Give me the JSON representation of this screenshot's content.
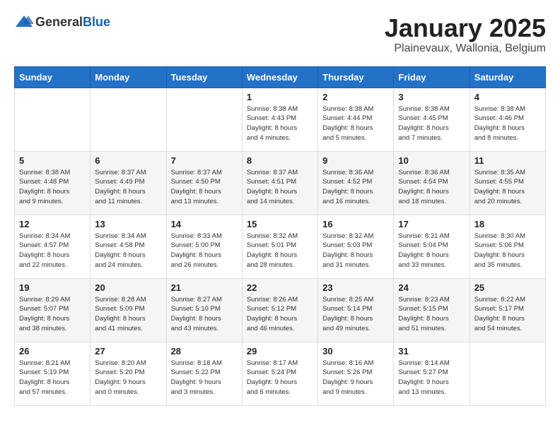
{
  "header": {
    "logo_general": "General",
    "logo_blue": "Blue",
    "month_title": "January 2025",
    "subtitle": "Plainevaux, Wallonia, Belgium"
  },
  "days_of_week": [
    "Sunday",
    "Monday",
    "Tuesday",
    "Wednesday",
    "Thursday",
    "Friday",
    "Saturday"
  ],
  "weeks": [
    [
      {
        "day": "",
        "info": ""
      },
      {
        "day": "",
        "info": ""
      },
      {
        "day": "",
        "info": ""
      },
      {
        "day": "1",
        "info": "Sunrise: 8:38 AM\nSunset: 4:43 PM\nDaylight: 8 hours\nand 4 minutes."
      },
      {
        "day": "2",
        "info": "Sunrise: 8:38 AM\nSunset: 4:44 PM\nDaylight: 8 hours\nand 5 minutes."
      },
      {
        "day": "3",
        "info": "Sunrise: 8:38 AM\nSunset: 4:45 PM\nDaylight: 8 hours\nand 7 minutes."
      },
      {
        "day": "4",
        "info": "Sunrise: 8:38 AM\nSunset: 4:46 PM\nDaylight: 8 hours\nand 8 minutes."
      }
    ],
    [
      {
        "day": "5",
        "info": "Sunrise: 8:38 AM\nSunset: 4:48 PM\nDaylight: 8 hours\nand 9 minutes."
      },
      {
        "day": "6",
        "info": "Sunrise: 8:37 AM\nSunset: 4:49 PM\nDaylight: 8 hours\nand 11 minutes."
      },
      {
        "day": "7",
        "info": "Sunrise: 8:37 AM\nSunset: 4:50 PM\nDaylight: 8 hours\nand 13 minutes."
      },
      {
        "day": "8",
        "info": "Sunrise: 8:37 AM\nSunset: 4:51 PM\nDaylight: 8 hours\nand 14 minutes."
      },
      {
        "day": "9",
        "info": "Sunrise: 8:36 AM\nSunset: 4:52 PM\nDaylight: 8 hours\nand 16 minutes."
      },
      {
        "day": "10",
        "info": "Sunrise: 8:36 AM\nSunset: 4:54 PM\nDaylight: 8 hours\nand 18 minutes."
      },
      {
        "day": "11",
        "info": "Sunrise: 8:35 AM\nSunset: 4:55 PM\nDaylight: 8 hours\nand 20 minutes."
      }
    ],
    [
      {
        "day": "12",
        "info": "Sunrise: 8:34 AM\nSunset: 4:57 PM\nDaylight: 8 hours\nand 22 minutes."
      },
      {
        "day": "13",
        "info": "Sunrise: 8:34 AM\nSunset: 4:58 PM\nDaylight: 8 hours\nand 24 minutes."
      },
      {
        "day": "14",
        "info": "Sunrise: 8:33 AM\nSunset: 5:00 PM\nDaylight: 8 hours\nand 26 minutes."
      },
      {
        "day": "15",
        "info": "Sunrise: 8:32 AM\nSunset: 5:01 PM\nDaylight: 8 hours\nand 28 minutes."
      },
      {
        "day": "16",
        "info": "Sunrise: 8:32 AM\nSunset: 5:03 PM\nDaylight: 8 hours\nand 31 minutes."
      },
      {
        "day": "17",
        "info": "Sunrise: 8:31 AM\nSunset: 5:04 PM\nDaylight: 8 hours\nand 33 minutes."
      },
      {
        "day": "18",
        "info": "Sunrise: 8:30 AM\nSunset: 5:06 PM\nDaylight: 8 hours\nand 35 minutes."
      }
    ],
    [
      {
        "day": "19",
        "info": "Sunrise: 8:29 AM\nSunset: 5:07 PM\nDaylight: 8 hours\nand 38 minutes."
      },
      {
        "day": "20",
        "info": "Sunrise: 8:28 AM\nSunset: 5:09 PM\nDaylight: 8 hours\nand 41 minutes."
      },
      {
        "day": "21",
        "info": "Sunrise: 8:27 AM\nSunset: 5:10 PM\nDaylight: 8 hours\nand 43 minutes."
      },
      {
        "day": "22",
        "info": "Sunrise: 8:26 AM\nSunset: 5:12 PM\nDaylight: 8 hours\nand 46 minutes."
      },
      {
        "day": "23",
        "info": "Sunrise: 8:25 AM\nSunset: 5:14 PM\nDaylight: 8 hours\nand 49 minutes."
      },
      {
        "day": "24",
        "info": "Sunrise: 8:23 AM\nSunset: 5:15 PM\nDaylight: 8 hours\nand 51 minutes."
      },
      {
        "day": "25",
        "info": "Sunrise: 8:22 AM\nSunset: 5:17 PM\nDaylight: 8 hours\nand 54 minutes."
      }
    ],
    [
      {
        "day": "26",
        "info": "Sunrise: 8:21 AM\nSunset: 5:19 PM\nDaylight: 8 hours\nand 57 minutes."
      },
      {
        "day": "27",
        "info": "Sunrise: 8:20 AM\nSunset: 5:20 PM\nDaylight: 9 hours\nand 0 minutes."
      },
      {
        "day": "28",
        "info": "Sunrise: 8:18 AM\nSunset: 5:22 PM\nDaylight: 9 hours\nand 3 minutes."
      },
      {
        "day": "29",
        "info": "Sunrise: 8:17 AM\nSunset: 5:24 PM\nDaylight: 9 hours\nand 6 minutes."
      },
      {
        "day": "30",
        "info": "Sunrise: 8:16 AM\nSunset: 5:26 PM\nDaylight: 9 hours\nand 9 minutes."
      },
      {
        "day": "31",
        "info": "Sunrise: 8:14 AM\nSunset: 5:27 PM\nDaylight: 9 hours\nand 13 minutes."
      },
      {
        "day": "",
        "info": ""
      }
    ]
  ]
}
